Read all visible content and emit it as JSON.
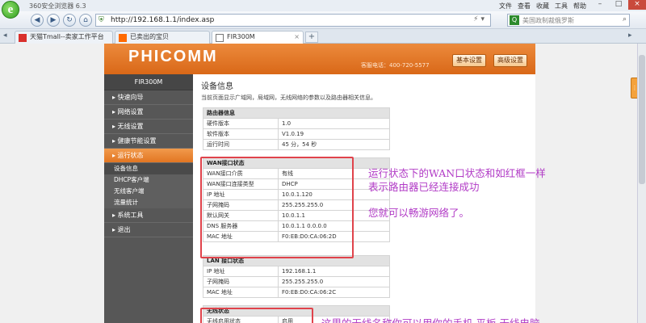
{
  "browser": {
    "title": "360安全浏览器 6.3",
    "menu": [
      "文件",
      "查看",
      "收藏",
      "工具",
      "帮助"
    ],
    "url": "http://192.168.1.1/index.asp",
    "search_placeholder": "美国政制裁俄罗斯",
    "tabs": [
      {
        "label": "天猫Tmall--卖家工作平台",
        "icon": "tmall-icon",
        "color": "#d9302c"
      },
      {
        "label": "已卖出的宝贝",
        "icon": "taobao-icon",
        "color": "#ff6a00"
      },
      {
        "label": "FIR300M",
        "icon": "page-icon",
        "color": "#777777"
      }
    ]
  },
  "router": {
    "logo": "PHICOMM",
    "hotline": "客服电话：400-720-5577",
    "buttons": {
      "basic": "基本设置",
      "advanced": "高级设置"
    },
    "model": "FIR300M",
    "menu": [
      {
        "label": "▸ 快速向导"
      },
      {
        "label": "▸ 网络设置"
      },
      {
        "label": "▸ 无线设置"
      },
      {
        "label": "▸ 健康节能设置"
      },
      {
        "label": "▸ 运行状态",
        "active": true,
        "sub": [
          "设备信息",
          "DHCP客户端",
          "无线客户端",
          "流量统计"
        ]
      },
      {
        "label": "▸ 系统工具"
      },
      {
        "label": "▸ 退出"
      }
    ],
    "page_title": "设备信息",
    "page_desc": "当前页面显示广域网，局域网，无线网络的参数以及路由器相关信息。",
    "router_info": {
      "header": "路由器信息",
      "rows": [
        [
          "硬件版本",
          "1.0"
        ],
        [
          "软件版本",
          "V1.0.19"
        ],
        [
          "运行时间",
          "45 分，54 秒"
        ]
      ]
    },
    "wan": {
      "header": "WAN接口状态",
      "rows": [
        [
          "WAN接口介质",
          "有线"
        ],
        [
          "WAN接口连接类型",
          "DHCP"
        ],
        [
          "IP 地址",
          "10.0.1.120"
        ],
        [
          "子网掩码",
          "255.255.255.0"
        ],
        [
          "默认网关",
          "10.0.1.1"
        ],
        [
          "DNS 服务器",
          "10.0.1.1 0.0.0.0"
        ],
        [
          "MAC 地址",
          "F0:EB:D0:CA:06:2D"
        ]
      ]
    },
    "lan": {
      "header": "LAN 接口状态",
      "rows": [
        [
          "IP 地址",
          "192.168.1.1"
        ],
        [
          "子网掩码",
          "255.255.255.0"
        ],
        [
          "MAC 地址",
          "F0:EB:D0:CA:06:2C"
        ]
      ]
    },
    "wireless": {
      "header": "无线状态",
      "rows": [
        [
          "无线启用状态",
          "启用"
        ]
      ]
    }
  },
  "annotations": {
    "line1": "运行状态下的WAN口状态和如红框一样",
    "line2": "表示路由器已经连接成功",
    "line3": "您就可以畅游网络了。",
    "line4": "这里的无线名称你可以用你的手机 平板 无线电脑"
  },
  "colors": {
    "header_orange": "#e47a2a",
    "annotation_purple": "#b13ac6",
    "highlight_red": "#e0434b",
    "sidebar_gray": "#575757"
  }
}
